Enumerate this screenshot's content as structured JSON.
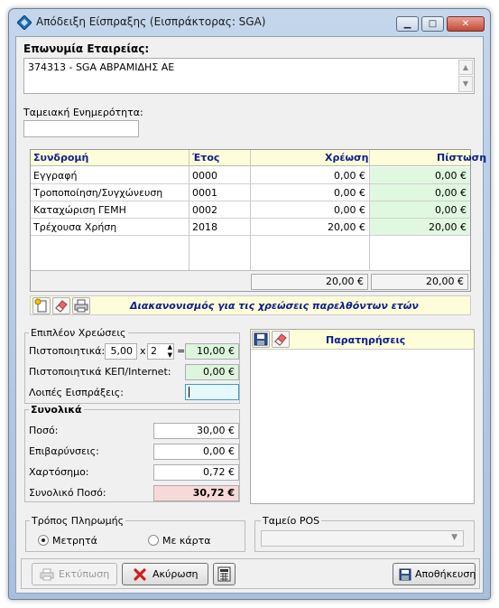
{
  "window": {
    "title": "Απόδειξη Είσπραξης (Εισπράκτορας: SGA)",
    "minimize": "▁",
    "maximize": "□",
    "close": "✕"
  },
  "company": {
    "label": "Επωνυμία Εταιρείας:",
    "value": "374313 - SGA ΑΒΡΑΜΙΔΗΣ ΑΕ"
  },
  "cash_status": {
    "label": "Ταμειακή Ενημερότητα:",
    "value": ""
  },
  "grid": {
    "headers": {
      "subscription": "Συνδρομή",
      "year": "Έτος",
      "debit": "Χρέωση",
      "credit": "Πίστωση"
    },
    "rows": [
      {
        "subscription": "Εγγραφή",
        "year": "0000",
        "debit": "0,00 €",
        "credit": "0,00 €"
      },
      {
        "subscription": "Τροποποίηση/Συγχώνευση",
        "year": "0001",
        "debit": "0,00 €",
        "credit": "0,00 €"
      },
      {
        "subscription": "Καταχώριση ΓΕΜΗ",
        "year": "0002",
        "debit": "0,00 €",
        "credit": "0,00 €"
      },
      {
        "subscription": "Τρέχουσα Χρήση",
        "year": "2018",
        "debit": "20,00 €",
        "credit": "20,00 €"
      }
    ],
    "totals": {
      "debit": "20,00 €",
      "credit": "20,00 €"
    }
  },
  "settlement": {
    "label": "Διακανονισμός για τις χρεώσεις παρελθόντων ετών"
  },
  "extra_charges": {
    "legend": "Επιπλέον Χρεώσεις",
    "certificates_label": "Πιστοποιητικά:",
    "certificates_price": "5,00",
    "times": "x",
    "certificates_qty": "2",
    "equals": "=",
    "certificates_total": "10,00 €",
    "kep_label": "Πιστοποιητικά ΚΕΠ/Internet:",
    "kep_value": "0,00 €",
    "other_label": "Λοιπές Εισπράξεις:",
    "other_value": ""
  },
  "totals": {
    "legend": "Συνολικά",
    "amount_label": "Ποσό:",
    "amount": "30,00 €",
    "surcharges_label": "Επιβαρύνσεις:",
    "surcharges": "0,00 €",
    "stamp_label": "Χαρτόσημο:",
    "stamp": "0,72 €",
    "total_label": "Συνολικό Ποσό:",
    "total": "30,72 €"
  },
  "notes": {
    "label": "Παρατηρήσεις",
    "value": ""
  },
  "payment": {
    "legend": "Τρόπος Πληρωμής",
    "cash": "Μετρητά",
    "card": "Με κάρτα",
    "selected": "cash"
  },
  "pos": {
    "legend": "Ταμείο POS",
    "value": ""
  },
  "buttons": {
    "print": "Εκτύπωση",
    "cancel": "Ακύρωση",
    "save": "Αποθήκευση"
  },
  "colors": {
    "header_text": "#0a1f8c",
    "credit_bg": "#e0f7e0",
    "total_bg": "#f7d9d9",
    "toolbar_bg": "#fdfdd9"
  }
}
